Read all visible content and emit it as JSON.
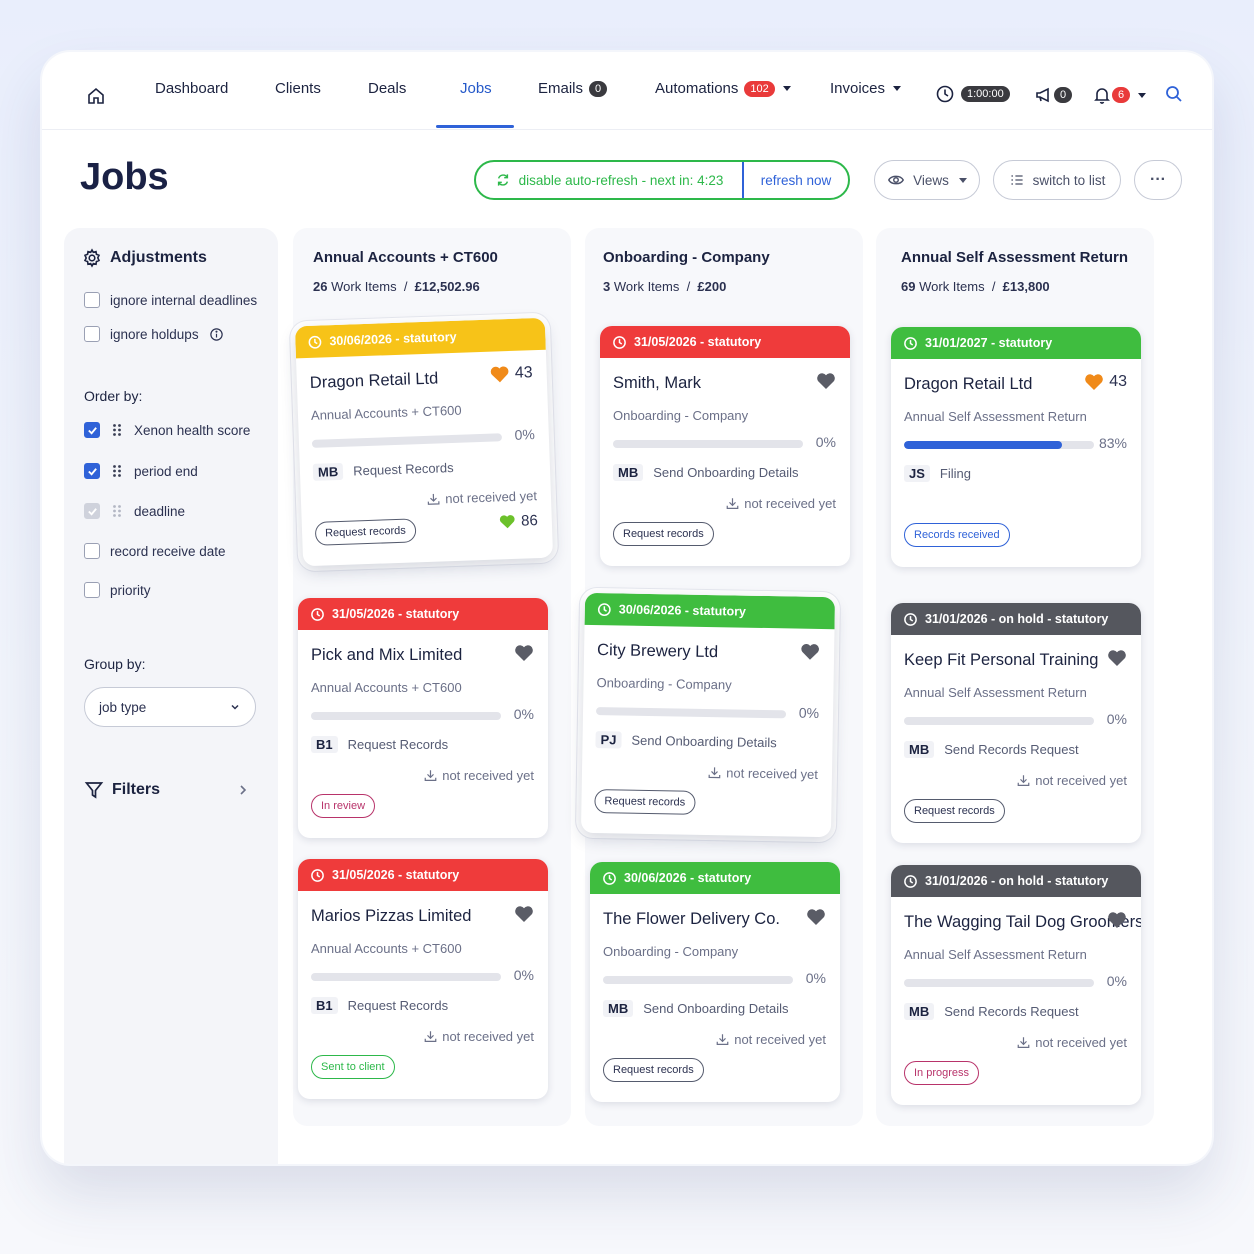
{
  "nav": {
    "items": [
      {
        "label": "Dashboard"
      },
      {
        "label": "Clients"
      },
      {
        "label": "Deals"
      },
      {
        "label": "Jobs"
      },
      {
        "label": "Emails",
        "badge": "0"
      },
      {
        "label": "Automations",
        "badge": "102"
      },
      {
        "label": "Invoices"
      }
    ],
    "timer": "1:00:00",
    "announcements_count": "0",
    "notifications_count": "6"
  },
  "header": {
    "title": "Jobs",
    "auto_refresh": "disable auto-refresh - next in: 4:23",
    "refresh_now": "refresh now",
    "views": "Views",
    "switch_to_list": "switch to list",
    "more": "···"
  },
  "sidebar": {
    "adjustments_title": "Adjustments",
    "options": [
      {
        "label": "ignore internal deadlines",
        "checked": false
      },
      {
        "label": "ignore holdups",
        "checked": false
      }
    ],
    "order_by_label": "Order by:",
    "order_by": [
      {
        "label": "Xenon health score",
        "checked": true
      },
      {
        "label": "period end",
        "checked": true
      },
      {
        "label": "deadline",
        "checked": true,
        "disabled": true
      },
      {
        "label": "record receive date",
        "checked": false
      },
      {
        "label": "priority",
        "checked": false
      }
    ],
    "group_by_label": "Group by:",
    "group_by_value": "job type",
    "filters_label": "Filters"
  },
  "columns": [
    {
      "title": "Annual Accounts + CT600",
      "count": "26",
      "items_label": "Work Items",
      "total": "£12,502.96",
      "cards": [
        {
          "date": "30/06/2026 - statutory",
          "color": "yellow",
          "name": "Dragon Retail Ltd",
          "type": "Annual Accounts + CT600",
          "score": "43",
          "heart": "orange",
          "progress": "0%",
          "progress_value": 0,
          "initials": "MB",
          "task": "Request Records",
          "status": "not received yet",
          "button": "Request records",
          "health": "86"
        },
        {
          "date": "31/05/2026 - statutory",
          "color": "red",
          "name": "Pick and Mix Limited",
          "type": "Annual Accounts + CT600",
          "score": "",
          "heart": "gray",
          "progress": "0%",
          "progress_value": 0,
          "initials": "B1",
          "task": "Request Records",
          "status": "not received yet",
          "button": "In review",
          "button_style": "pink"
        },
        {
          "date": "31/05/2026 - statutory",
          "color": "red",
          "name": "Marios Pizzas Limited",
          "type": "Annual Accounts + CT600",
          "score": "",
          "heart": "gray",
          "progress": "0%",
          "progress_value": 0,
          "initials": "B1",
          "task": "Request Records",
          "status": "not received yet",
          "button": "Sent to client",
          "button_style": "green"
        }
      ]
    },
    {
      "title": "Onboarding - Company",
      "count": "3",
      "items_label": "Work Items",
      "total": "£200",
      "cards": [
        {
          "date": "31/05/2026 - statutory",
          "color": "red",
          "name": "Smith, Mark",
          "type": "Onboarding - Company",
          "score": "",
          "heart": "gray",
          "progress": "0%",
          "progress_value": 0,
          "initials": "MB",
          "task": "Send Onboarding Details",
          "status": "not received yet",
          "button": "Request records"
        },
        {
          "date": "30/06/2026 - statutory",
          "color": "green",
          "name": "City Brewery Ltd",
          "type": "Onboarding - Company",
          "score": "",
          "heart": "gray",
          "progress": "0%",
          "progress_value": 0,
          "initials": "PJ",
          "task": "Send Onboarding Details",
          "status": "not received yet",
          "button": "Request records"
        },
        {
          "date": "30/06/2026 - statutory",
          "color": "green",
          "name": "The Flower Delivery Co.",
          "type": "Onboarding - Company",
          "score": "",
          "heart": "gray",
          "progress": "0%",
          "progress_value": 0,
          "initials": "MB",
          "task": "Send Onboarding Details",
          "status": "not received yet",
          "button": "Request records"
        }
      ]
    },
    {
      "title": "Annual Self Assessment Return",
      "count": "69",
      "items_label": "Work Items",
      "total": "£13,800",
      "cards": [
        {
          "date": "31/01/2027 - statutory",
          "color": "green",
          "name": "Dragon Retail Ltd",
          "type": "Annual Self Assessment Return",
          "score": "43",
          "heart": "orange",
          "progress": "83%",
          "progress_value": 83,
          "initials": "JS",
          "task": "Filing",
          "status": "",
          "button": "Records received",
          "button_style": "blue"
        },
        {
          "date": "31/01/2026 - on hold - statutory",
          "color": "gray",
          "name": "Keep Fit Personal Training",
          "type": "Annual Self Assessment Return",
          "score": "",
          "heart": "gray",
          "progress": "0%",
          "progress_value": 0,
          "initials": "MB",
          "task": "Send Records Request",
          "status": "not received yet",
          "button": "Request records"
        },
        {
          "date": "31/01/2026 - on hold - statutory",
          "color": "gray",
          "name": "The Wagging Tail Dog Groomers",
          "type": "Annual Self Assessment Return",
          "score": "",
          "heart": "gray",
          "progress": "0%",
          "progress_value": 0,
          "initials": "MB",
          "task": "Send Records Request",
          "status": "not received yet",
          "button": "In progress",
          "button_style": "pink"
        }
      ]
    }
  ]
}
